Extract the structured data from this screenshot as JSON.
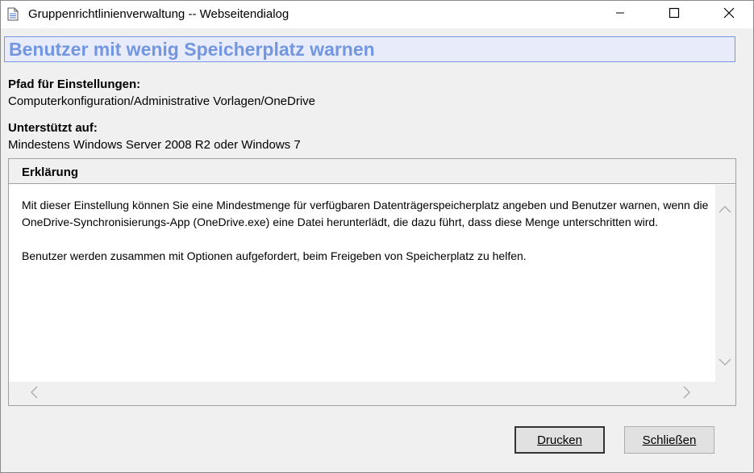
{
  "window": {
    "title": "Gruppenrichtlinienverwaltung -- Webseitendialog",
    "controls": {
      "minimize": "minimize-icon",
      "maximize": "maximize-icon",
      "close": "close-icon"
    }
  },
  "policy": {
    "title": "Benutzer mit wenig Speicherplatz warnen",
    "path_label": "Pfad für Einstellungen:",
    "path_value": "Computerkonfiguration/Administrative Vorlagen/OneDrive",
    "supported_label": "Unterstützt auf:",
    "supported_value": "Mindestens Windows Server 2008 R2 oder Windows 7"
  },
  "explanation": {
    "header": "Erklärung",
    "paragraphs": [
      "Mit dieser Einstellung können Sie eine Mindestmenge für verfügbaren Datenträgerspeicherplatz angeben und Benutzer warnen, wenn die OneDrive-Synchronisierungs-App (OneDrive.exe) eine Datei herunterlädt, die dazu führt, dass diese Menge unterschritten wird.",
      "Benutzer werden zusammen mit Optionen aufgefordert, beim Freigeben von Speicherplatz zu helfen."
    ]
  },
  "buttons": {
    "print": "Drucken",
    "close": "Schließen"
  },
  "colors": {
    "title_text": "#7296e0",
    "title_bg": "#e8ecfa",
    "title_border": "#7a96df"
  }
}
